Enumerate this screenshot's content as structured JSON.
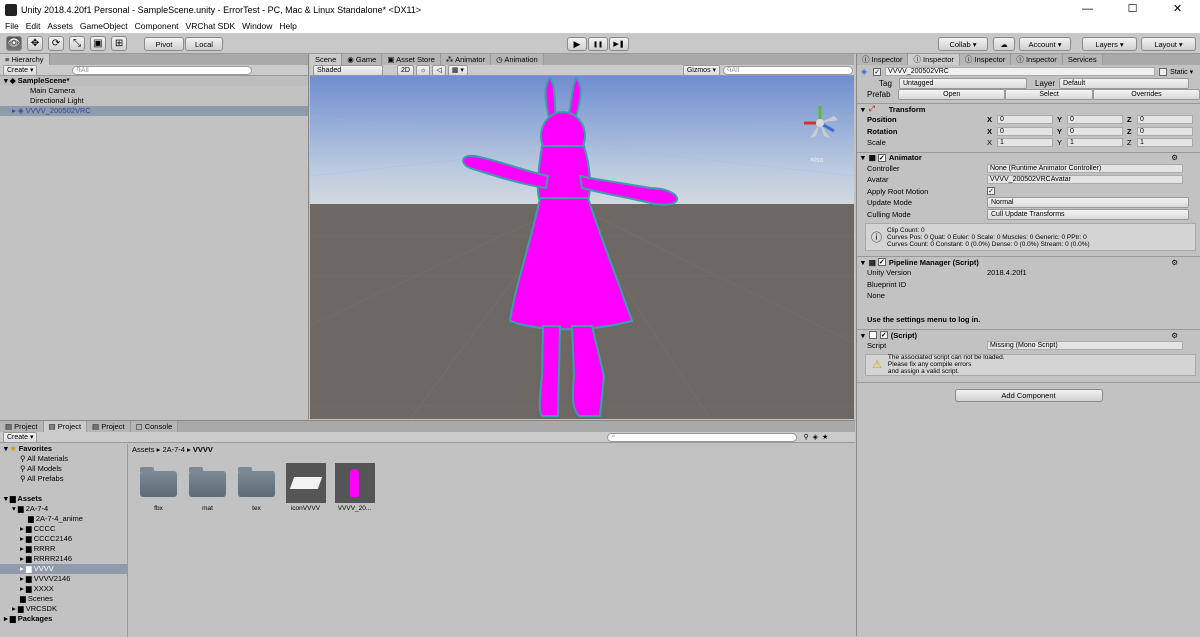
{
  "window": {
    "title": "Unity 2018.4.20f1 Personal - SampleScene.unity - ErrorTest - PC, Mac & Linux Standalone* <DX11>",
    "minimize": "—",
    "maximize": "☐",
    "close": "✕"
  },
  "menu": [
    "File",
    "Edit",
    "Assets",
    "GameObject",
    "Component",
    "VRChat SDK",
    "Window",
    "Help"
  ],
  "toolbar": {
    "pivot": "Pivot",
    "local": "Local",
    "collab": "Collab ▾",
    "account": "Account ▾",
    "layers": "Layers ▾",
    "layout": "Layout ▾",
    "play": "▶",
    "pause": "❚❚",
    "step": "▶❚"
  },
  "hierarchy": {
    "tab": "Hierarchy",
    "create": "Create ▾",
    "search_placeholder": "ᑫAll",
    "scene": "SampleScene*",
    "items": [
      "Main Camera",
      "Directional Light",
      "VVVV_200502VRC"
    ]
  },
  "scene_tabs": [
    "Scene",
    "Game",
    "Asset Store",
    "Animator",
    "Animation"
  ],
  "scene_bar": {
    "shading": "Shaded",
    "mode_2d": "2D",
    "gizmos": "Gizmos ▾",
    "search_placeholder": "ᑫAll"
  },
  "gizmo": {
    "label": "≡Iso"
  },
  "project": {
    "tabs": [
      "Project",
      "Project",
      "Project",
      "Console"
    ],
    "create": "Create ▾",
    "breadcrumb": [
      "Assets",
      "2A-7-4",
      "VVVV"
    ],
    "favorites": {
      "label": "Favorites",
      "items": [
        "All Materials",
        "All Models",
        "All Prefabs"
      ]
    },
    "assets_label": "Assets",
    "tree": [
      "2A-7-4",
      "2A-7-4_anime",
      "CCCC",
      "CCCC2146",
      "RRRR",
      "RRRR2146",
      "VVVV",
      "VVVV2146",
      "XXXX",
      "Scenes",
      "VRCSDK"
    ],
    "packages": "Packages",
    "assets": [
      "fbx",
      "mat",
      "tex",
      "iconVVVV",
      "VVVV_20..."
    ]
  },
  "inspector": {
    "tabs": [
      "Inspector",
      "Inspector",
      "Inspector",
      "Inspector",
      "Services"
    ],
    "object_name": "VVVV_200502VRC",
    "static": "Static ▾",
    "tag_label": "Tag",
    "tag_value": "Untagged",
    "layer_label": "Layer",
    "layer_value": "Default",
    "prefab_label": "Prefab",
    "prefab_open": "Open",
    "prefab_select": "Select",
    "prefab_overrides": "Overrides",
    "transform": {
      "title": "Transform",
      "position": "Position",
      "rotation": "Rotation",
      "scale": "Scale",
      "pos": [
        "0",
        "0",
        "0"
      ],
      "rot": [
        "0",
        "0",
        "0"
      ],
      "scl": [
        "1",
        "1",
        "1"
      ]
    },
    "animator": {
      "title": "Animator",
      "controller_label": "Controller",
      "controller_value": "None (Runtime Animator Controller)",
      "avatar_label": "Avatar",
      "avatar_value": "VVVV_200502VRCAvatar",
      "apply_root_label": "Apply Root Motion",
      "update_mode_label": "Update Mode",
      "update_mode_value": "Normal",
      "culling_label": "Culling Mode",
      "culling_value": "Cull Update Transforms",
      "info": [
        "Clip Count: 0",
        "Curves Pos: 0 Quat: 0 Euler: 0 Scale: 0 Muscles: 0 Generic: 0 PPtr: 0",
        "Curves Count: 0 Constant: 0 (0.0%) Dense: 0 (0.0%) Stream: 0 (0.0%)"
      ]
    },
    "pipeline": {
      "title": "Pipeline Manager (Script)",
      "unity_version_label": "Unity Version",
      "unity_version_value": "2018.4.20f1",
      "blueprint_label": "Blueprint ID",
      "none": "None",
      "login_msg": "Use the settings menu to log in."
    },
    "script": {
      "title": "(Script)",
      "script_label": "Script",
      "script_value": "Missing (Mono Script)",
      "warning": [
        "The associated script can not be loaded.",
        "Please fix any compile errors",
        "and assign a valid script."
      ]
    },
    "add_component": "Add Component"
  }
}
